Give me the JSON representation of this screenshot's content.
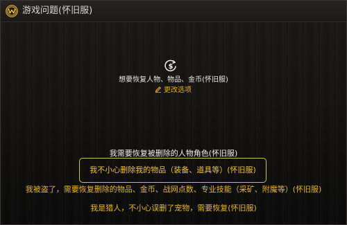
{
  "window": {
    "title": "游戏问题(怀旧服)"
  },
  "summary": {
    "text": "想要恢复人物、物品、金币(怀旧服)",
    "change_label": "更改选项"
  },
  "options": [
    {
      "label": "我需要恢复被删除的人物角色(怀旧服)"
    },
    {
      "label": "我不小心删除我的物品（装备、道具等）(怀旧服)",
      "selected": true
    },
    {
      "label": "我被盗了，需要恢复删除的物品、金币、战网点数、专业技能（采矿、附魔等）(怀旧服)"
    },
    {
      "label": "我是猎人，不小心误删了宠物，需要恢复(怀旧服)"
    }
  ],
  "colors": {
    "accent": "#e8b624",
    "selected_border": "#c8c44a",
    "text": "#e8e6e2"
  },
  "icons": {
    "logo": "wow-logo-icon",
    "restore": "restore-dollar-icon",
    "edit": "pencil-icon"
  }
}
